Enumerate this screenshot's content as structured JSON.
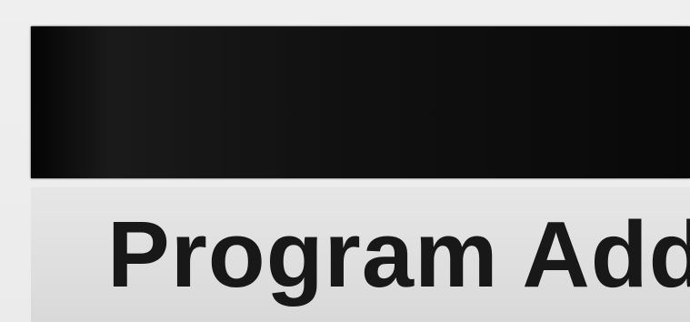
{
  "menu": {
    "items": [
      {
        "label": "Program Add"
      }
    ]
  },
  "colors": {
    "header_bar": "#0f0f0f",
    "background": "#ececec",
    "item_background": "#dedede",
    "text": "#181818"
  }
}
